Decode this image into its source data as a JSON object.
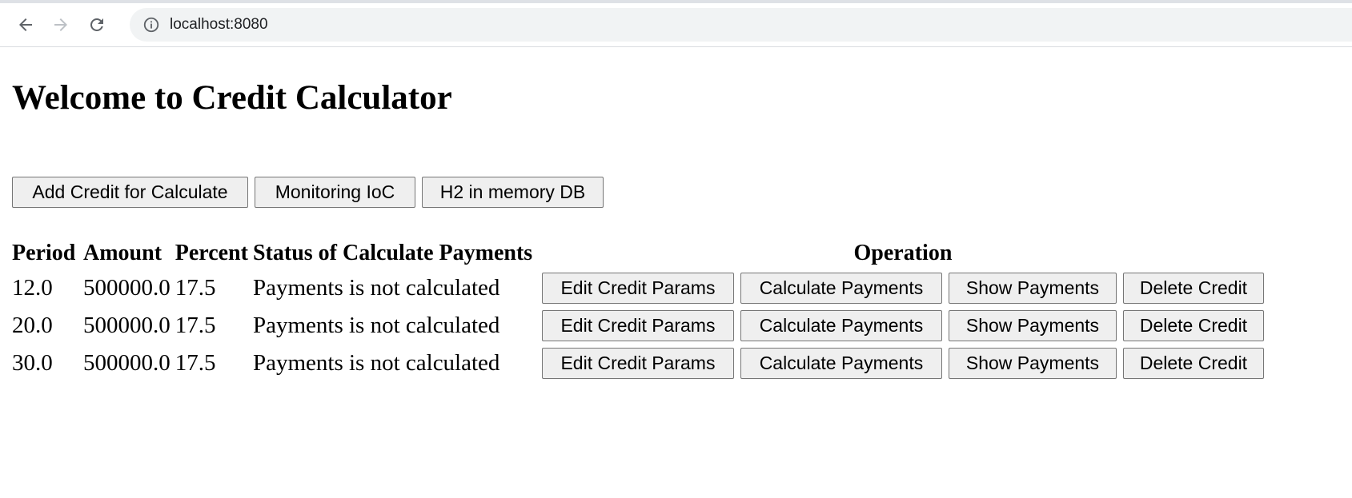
{
  "browser": {
    "url": "localhost:8080"
  },
  "page": {
    "title": "Welcome to Credit Calculator",
    "buttons": {
      "add_credit": "Add Credit for Calculate",
      "monitoring": "Monitoring IoC",
      "h2_db": "H2 in memory DB"
    },
    "table": {
      "headers": {
        "period": "Period",
        "amount": "Amount",
        "percent": "Percent",
        "status": "Status of Calculate Payments",
        "operation": "Operation"
      },
      "rows": [
        {
          "period": "12.0",
          "amount": "500000.0",
          "percent": "17.5",
          "status": "Payments is not calculated"
        },
        {
          "period": "20.0",
          "amount": "500000.0",
          "percent": "17.5",
          "status": "Payments is not calculated"
        },
        {
          "period": "30.0",
          "amount": "500000.0",
          "percent": "17.5",
          "status": "Payments is not calculated"
        }
      ],
      "operation_labels": {
        "edit": "Edit Credit Params",
        "calculate": "Calculate Payments",
        "show": "Show Payments",
        "delete": "Delete Credit"
      }
    }
  }
}
